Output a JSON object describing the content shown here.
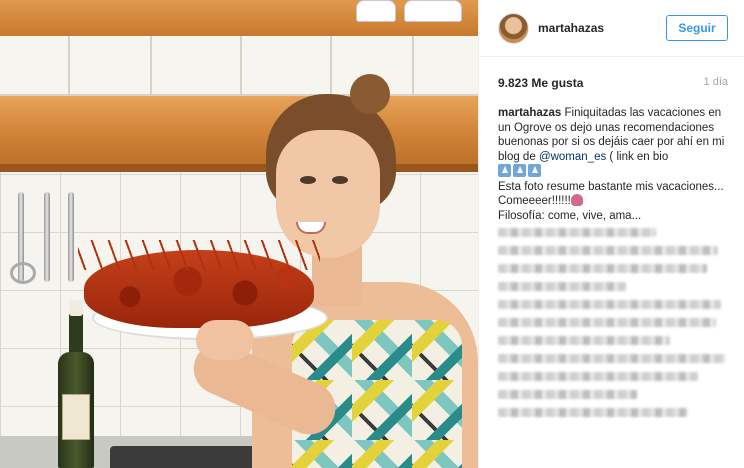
{
  "post": {
    "username": "martahazas",
    "follow_label": "Seguir",
    "likes": "9.823 Me gusta",
    "timestamp": "1 día",
    "caption": {
      "author": "martahazas",
      "line1": "Finiquitadas las vacaciones en un Ogrove os dejo unas recomendaciones buenonas por si os dejáis caer por ahí en mi blog de ",
      "mention": "@woman_es",
      "line1_end": " ( link en bio",
      "line2": "Esta foto resume bastante mis vacaciones... Comeeeer!!!!!!",
      "line3": "Filosofía: come, vive, ama..."
    },
    "emojis": [
      "arrow-up-icon",
      "arrow-up-icon",
      "arrow-up-icon",
      "octopus-icon"
    ],
    "comment_line_widths_pct": [
      68,
      95,
      90,
      55,
      96,
      94,
      74,
      98,
      86,
      60,
      82
    ]
  },
  "colors": {
    "accent": "#3897f0",
    "text": "#262626",
    "muted": "#a5a5a5",
    "mention": "#003569"
  }
}
